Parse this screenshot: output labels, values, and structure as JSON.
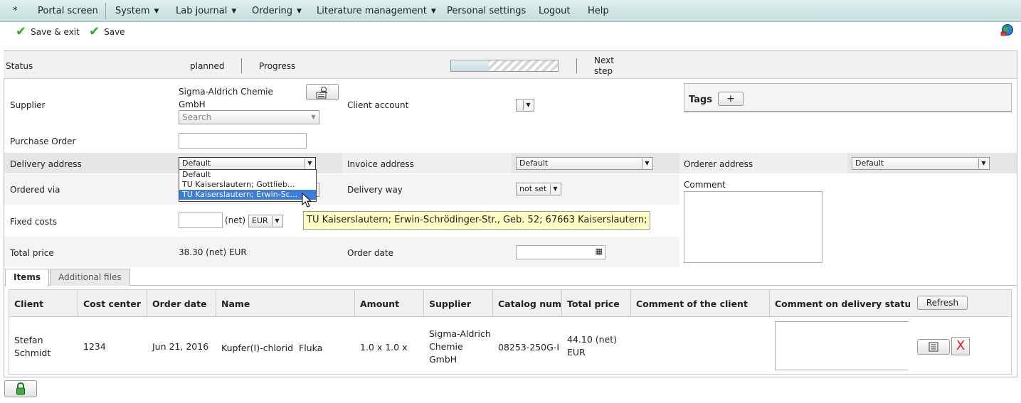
{
  "menu": {
    "star": "*",
    "items": [
      {
        "label": "Portal screen",
        "dropdown": false
      },
      {
        "label": "System",
        "dropdown": true
      },
      {
        "label": "Lab journal",
        "dropdown": true
      },
      {
        "label": "Ordering",
        "dropdown": true
      },
      {
        "label": "Literature management",
        "dropdown": true
      },
      {
        "label": "Personal settings",
        "dropdown": false
      },
      {
        "label": "Logout",
        "dropdown": false
      },
      {
        "label": "Help",
        "dropdown": false
      }
    ]
  },
  "toolbar": {
    "save_exit_label": "Save & exit",
    "save_label": "Save"
  },
  "status": {
    "label": "Status",
    "value": "planned",
    "progress_label": "Progress",
    "progress_fraction": 0.35,
    "next_step_label": "Next step"
  },
  "form": {
    "supplier_label": "Supplier",
    "supplier_value": "Sigma-Aldrich Chemie GmbH",
    "supplier_search_placeholder": "Search",
    "client_account_label": "Client account",
    "tags_label": "Tags",
    "tags_add": "+",
    "purchase_order_label": "Purchase Order",
    "delivery_address_label": "Delivery address",
    "delivery_address_value": "Default",
    "invoice_address_label": "Invoice address",
    "invoice_address_value": "Default",
    "orderer_address_label": "Orderer address",
    "orderer_address_value": "Default",
    "ordered_via_label": "Ordered via",
    "delivery_way_label": "Delivery way",
    "delivery_way_value": "not set",
    "comment_label": "Comment",
    "fixed_costs_label": "Fixed costs",
    "fixed_costs_net": "(net)",
    "currency": "EUR",
    "total_price_label": "Total price",
    "total_price_value": "38.30 (net) EUR",
    "order_date_label": "Order date"
  },
  "dropdown": {
    "options": [
      "Default",
      "TU Kaiserslautern; Gottlieb...",
      "TU Kaiserslautern; Erwin-Sc..."
    ],
    "selected_index": 2,
    "tooltip": "TU Kaiserslautern; Erwin-Schrödinger-Str., Geb. 52; 67663 Kaiserslautern;"
  },
  "tabs": [
    {
      "label": "Items",
      "active": true
    },
    {
      "label": "Additional files",
      "active": false
    }
  ],
  "table": {
    "headers": [
      "Client",
      "Cost center",
      "Order date",
      "Name",
      "Amount",
      "Supplier",
      "Catalog numb",
      "Total price",
      "Comment of the client",
      "Comment on delivery status"
    ],
    "refresh_label": "Refresh",
    "row": {
      "client": "Stefan Schmidt",
      "cost_center": "1234",
      "order_date": "Jun 21, 2016",
      "name": "Kupfer(I)-chlorid  Fluka",
      "amount": "1.0 x 1.0 x",
      "supplier": "Sigma-Aldrich Chemie GmbH",
      "catalog_number": "08253-250G-I",
      "total_price": "44.10 (net) EUR",
      "delete_label": "X"
    }
  },
  "colors": {
    "accent_check": "#2bb020",
    "menu_bg": "#d2e7e6",
    "delete_red": "#e02020",
    "selection": "#3b7dd8",
    "tooltip_bg": "#ffffc4"
  }
}
